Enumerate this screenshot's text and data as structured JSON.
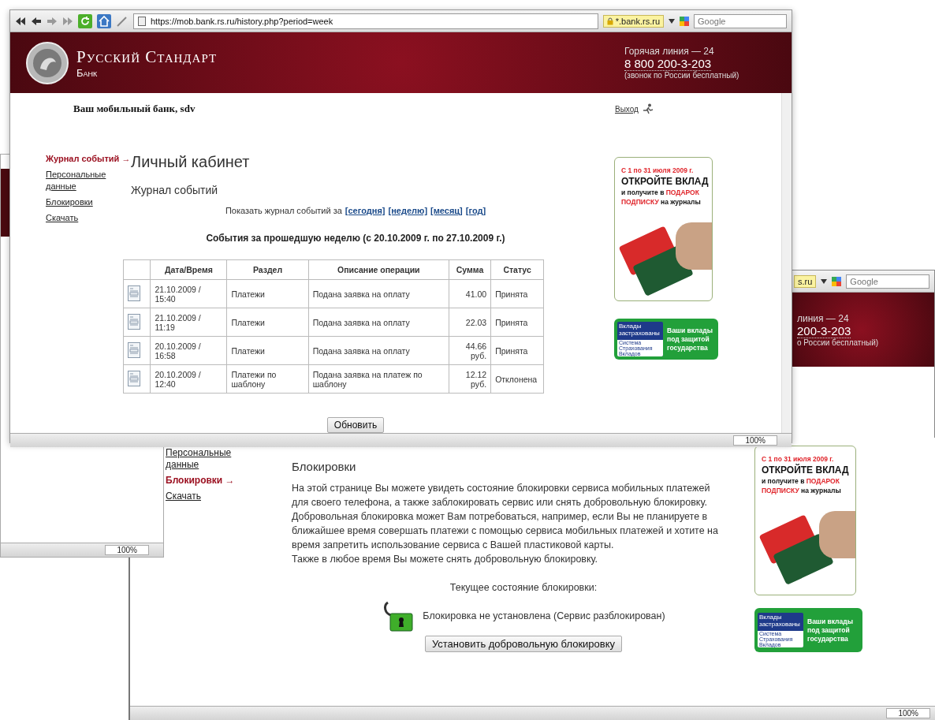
{
  "left_window": {
    "zoom": "100%"
  },
  "right_window": {
    "address_fragment": "s.ru",
    "search_placeholder": "Google",
    "hotline_label": "линия — 24",
    "hotline_phone": "200-3-203",
    "hotline_note": "о России бесплатный)"
  },
  "front_window": {
    "url": "https://mob.bank.rs.ru/history.php?period=week",
    "security_badge": "*.bank.rs.ru",
    "search_placeholder": "Google",
    "bank_name": "Русский Стандарт",
    "bank_sub": "Банк",
    "hotline_label": "Горячая линия — 24",
    "hotline_phone": "8 800 200-3-203",
    "hotline_note": "(звонок по России бесплатный)",
    "greeting": "Ваш мобильный банк,  sdv",
    "logout": "Выход",
    "sidebar": [
      {
        "label": "Журнал событий →",
        "selected": true
      },
      {
        "label": "Персональные данные",
        "selected": false
      },
      {
        "label": "Блокировки",
        "selected": false
      },
      {
        "label": "Скачать",
        "selected": false
      }
    ],
    "page_title": "Личный кабинет",
    "section_title": "Журнал событий",
    "period_prompt": "Показать журнал событий за",
    "period_links": [
      "[сегодня]",
      "[неделю]",
      "[месяц]",
      "[год]"
    ],
    "summary": "События за прошедшую неделю (с 20.10.2009 г. по 27.10.2009 г.)",
    "table": {
      "columns": [
        "Дата/Время",
        "Раздел",
        "Описание операции",
        "Сумма",
        "Статус"
      ],
      "rows": [
        {
          "datetime": "21.10.2009 / 15:40",
          "section": "Платежи",
          "description": "Подана заявка на оплату",
          "amount": "41.00",
          "status": "Принята"
        },
        {
          "datetime": "21.10.2009 / 11:19",
          "section": "Платежи",
          "description": "Подана заявка на оплату",
          "amount": "22.03",
          "status": "Принята"
        },
        {
          "datetime": "20.10.2009 / 16:58",
          "section": "Платежи",
          "description": "Подана заявка на оплату",
          "amount": "44.66 руб.",
          "status": "Принята"
        },
        {
          "datetime": "20.10.2009 / 12:40",
          "section": "Платежи по шаблону",
          "description": "Подана заявка на платеж по шаблону",
          "amount": "12.12 руб.",
          "status": "Отклонена"
        }
      ]
    },
    "refresh_button": "Обновить",
    "zoom": "100%",
    "ad": {
      "lines": [
        [
          {
            "text": "С 1 по 31 июля 2009 г.",
            "accent": true
          }
        ],
        [
          {
            "text": "ОТКРОЙТЕ ВКЛАД",
            "accent": false
          }
        ],
        [
          {
            "text": "и получите в ",
            "accent": false
          },
          {
            "text": "ПОДАРОК",
            "accent": true
          }
        ],
        [
          {
            "text": "ПОДПИСКУ",
            "accent": true
          },
          {
            "text": " на журналы",
            "accent": false
          }
        ]
      ]
    },
    "insurance": {
      "badge_title": "Вклады застрахованы",
      "badge_org": "Система Страхования Вкладов",
      "slogan": "Ваши вклады под защитой государства"
    }
  },
  "bottom_window": {
    "sidebar": [
      {
        "label": "Персональные данные",
        "selected": false
      },
      {
        "label": "Блокировки →",
        "selected": true
      },
      {
        "label": "Скачать",
        "selected": false
      }
    ],
    "section_title": "Блокировки",
    "paragraphs": [
      "На этой странице Вы можете увидеть состояние блокировки сервиса мобильных платежей для своего телефона, а также заблокировать сервис или снять добровольную блокировку.",
      "Добровольная блокировка может Вам потребоваться, например, если Вы не планируете в ближайшее время совершать платежи с помощью сервиса мобильных платежей и хотите на время запретить использование сервиса с Вашей пластиковой карты.",
      "Также в любое время Вы можете снять добровольную блокировку."
    ],
    "status_label": "Текущее состояние блокировки:",
    "lock": {
      "locked": false
    },
    "status_text": "Блокировка не установлена (Сервис разблокирован)",
    "lock_button": "Установить добровольную блокировку",
    "zoom": "100%",
    "ad": {
      "lines": [
        [
          {
            "text": "С 1 по 31 июля 2009 г.",
            "accent": true
          }
        ],
        [
          {
            "text": "ОТКРОЙТЕ ВКЛАД",
            "accent": false
          }
        ],
        [
          {
            "text": "и получите в ",
            "accent": false
          },
          {
            "text": "ПОДАРОК",
            "accent": true
          }
        ],
        [
          {
            "text": "ПОДПИСКУ",
            "accent": true
          },
          {
            "text": " на журналы",
            "accent": false
          }
        ]
      ]
    },
    "insurance": {
      "badge_title": "Вклады застрахованы",
      "badge_org": "Система Страхования Вкладов",
      "slogan": "Ваши вклады под защитой государства"
    }
  }
}
